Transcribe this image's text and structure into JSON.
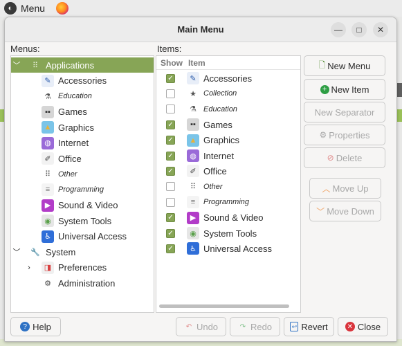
{
  "panel": {
    "menu_label": "Menu"
  },
  "window": {
    "title": "Main Menu"
  },
  "menus_label": "Menus:",
  "items_label": "Items:",
  "items_columns": {
    "show": "Show",
    "item": "Item"
  },
  "tree": [
    {
      "label": "Applications",
      "icon": "grid-icon",
      "selected": true,
      "expander": "﹀",
      "level": 0
    },
    {
      "label": "Accessories",
      "icon": "accessories-icon",
      "level": 1
    },
    {
      "label": "Education",
      "icon": "flask-icon",
      "level": 1,
      "italic": true
    },
    {
      "label": "Games",
      "icon": "gamepad-icon",
      "level": 1
    },
    {
      "label": "Graphics",
      "icon": "graphics-icon",
      "level": 1
    },
    {
      "label": "Internet",
      "icon": "globe-icon",
      "level": 1
    },
    {
      "label": "Office",
      "icon": "office-icon",
      "level": 1
    },
    {
      "label": "Other",
      "icon": "dots-icon",
      "level": 1,
      "italic": true
    },
    {
      "label": "Programming",
      "icon": "document-icon",
      "level": 1,
      "italic": true
    },
    {
      "label": "Sound & Video",
      "icon": "play-icon",
      "level": 1
    },
    {
      "label": "System Tools",
      "icon": "toggle-icon",
      "level": 1
    },
    {
      "label": "Universal Access",
      "icon": "accessibility-icon",
      "level": 1
    },
    {
      "label": "System",
      "icon": "wrench-icon",
      "level": 0,
      "expander": "﹀"
    },
    {
      "label": "Preferences",
      "icon": "preferences-icon",
      "level": 1,
      "expander": "›"
    },
    {
      "label": "Administration",
      "icon": "gear-icon",
      "level": 1
    }
  ],
  "items": [
    {
      "label": "Accessories",
      "icon": "accessories-icon",
      "show": true
    },
    {
      "label": "Collection",
      "icon": "star-icon",
      "show": false,
      "italic": true
    },
    {
      "label": "Education",
      "icon": "flask-icon",
      "show": false,
      "italic": true
    },
    {
      "label": "Games",
      "icon": "gamepad-icon",
      "show": true
    },
    {
      "label": "Graphics",
      "icon": "graphics-icon",
      "show": true
    },
    {
      "label": "Internet",
      "icon": "globe-icon",
      "show": true
    },
    {
      "label": "Office",
      "icon": "office-icon",
      "show": true
    },
    {
      "label": "Other",
      "icon": "dots-icon",
      "show": false,
      "italic": true
    },
    {
      "label": "Programming",
      "icon": "document-icon",
      "show": false,
      "italic": true
    },
    {
      "label": "Sound & Video",
      "icon": "play-icon",
      "show": true
    },
    {
      "label": "System Tools",
      "icon": "toggle-icon",
      "show": true
    },
    {
      "label": "Universal Access",
      "icon": "accessibility-icon",
      "show": true
    }
  ],
  "side_buttons": {
    "new_menu": "New Menu",
    "new_item": "New Item",
    "new_separator": "New Separator",
    "properties": "Properties",
    "delete": "Delete",
    "move_up": "Move Up",
    "move_down": "Move Down"
  },
  "bottom_buttons": {
    "help": "Help",
    "undo": "Undo",
    "redo": "Redo",
    "revert": "Revert",
    "close": "Close"
  },
  "colors": {
    "accent": "#87a556",
    "danger": "#d9343c",
    "help_blue": "#2f72c4"
  }
}
